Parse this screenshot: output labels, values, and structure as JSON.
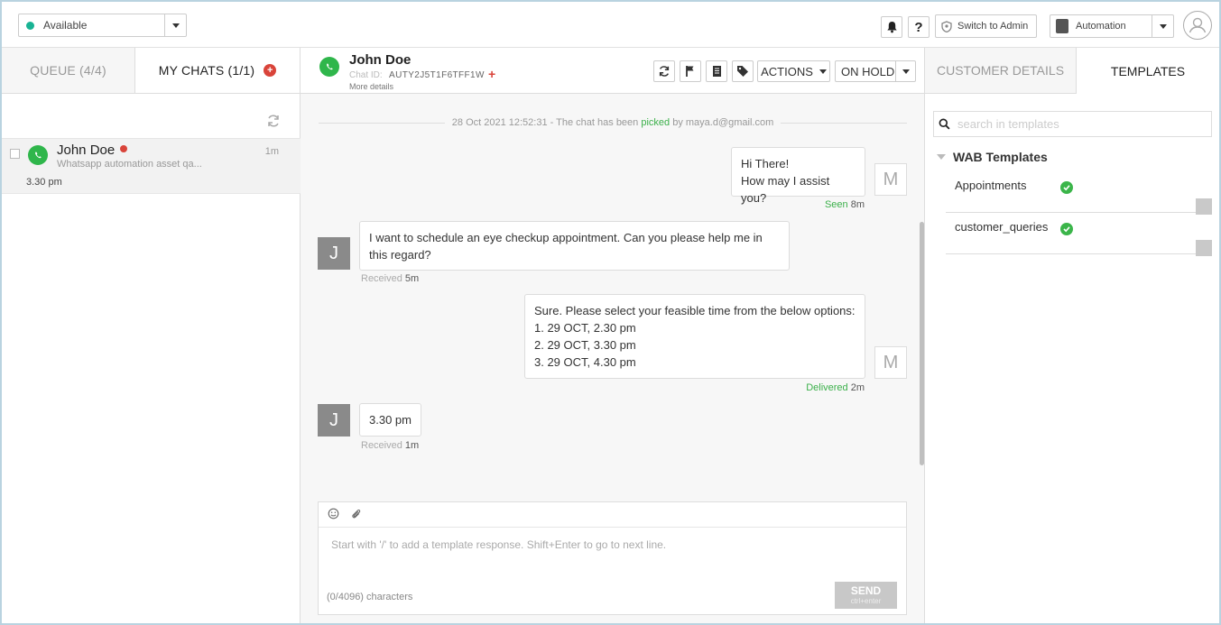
{
  "topbar": {
    "status": "Available",
    "switch_admin": "Switch to Admin",
    "workspace": "Automation"
  },
  "left": {
    "tabs": [
      "QUEUE (4/4)",
      "MY CHATS (1/1)"
    ],
    "plus_glyph": "+",
    "chat": {
      "name": "John Doe",
      "preview": "Whatsapp automation asset qa...",
      "time_ago": "1m",
      "last_message": "3.30 pm"
    }
  },
  "header": {
    "name": "John Doe",
    "chat_id_label": "Chat ID:",
    "chat_id": "AUTY2J5T1F6TFF1W",
    "plus_glyph": "+",
    "more_details": "More details",
    "actions_label": "ACTIONS",
    "on_hold_label": "ON HOLD"
  },
  "conversation": {
    "system": {
      "pre": "28 Oct 2021 12:52:31 - The chat has been ",
      "picked": "picked",
      "post": " by maya.d@gmail.com"
    },
    "messages": [
      {
        "from": "agent",
        "avatar": "M",
        "lines": [
          "Hi There!",
          "How may I assist you?"
        ],
        "status": "Seen",
        "ago": "8m"
      },
      {
        "from": "user",
        "avatar": "J",
        "lines": [
          "I want to schedule an eye checkup appointment. Can you please help me in",
          "this regard?"
        ],
        "status": "Received",
        "ago": "5m"
      },
      {
        "from": "agent",
        "avatar": "M",
        "lines": [
          "Sure. Please select your feasible time from the below options:",
          "1. 29 OCT, 2.30 pm",
          "2. 29 OCT, 3.30 pm",
          "3. 29 OCT, 4.30 pm"
        ],
        "status": "Delivered",
        "ago": "2m"
      },
      {
        "from": "user",
        "avatar": "J",
        "lines": [
          "3.30 pm"
        ],
        "status": "Received",
        "ago": "1m"
      }
    ]
  },
  "composer": {
    "placeholder": "Start with '/' to add a template response. Shift+Enter to go to next line.",
    "counter": "(0/4096) characters",
    "send_label": "SEND",
    "send_hint": "ctrl+enter"
  },
  "right": {
    "tabs": [
      "CUSTOMER DETAILS",
      "TEMPLATES"
    ],
    "search_placeholder": "search in templates",
    "group": "WAB Templates",
    "templates": [
      "Appointments",
      "customer_queries"
    ]
  },
  "colors": {
    "accent_green": "#2fb64b",
    "status_green": "#19b394",
    "alert_red": "#d9443a"
  }
}
